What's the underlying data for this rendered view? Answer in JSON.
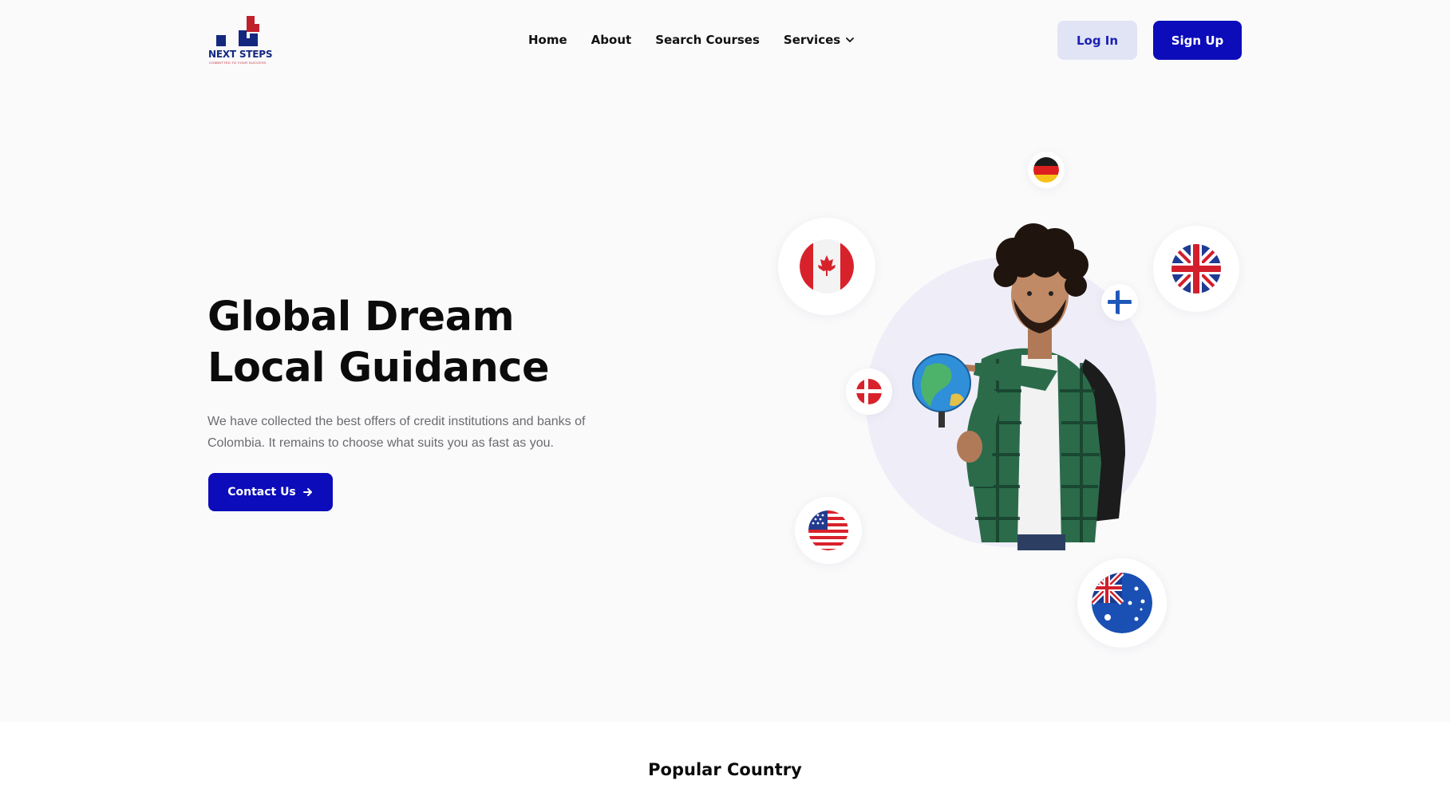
{
  "brand": {
    "name": "NEXT STEPS",
    "tagline": "COMMITTED TO YOUR SUCCESS",
    "colors": {
      "primary": "#0c0cba",
      "logo_blue": "#14287f",
      "logo_red": "#c0202a"
    }
  },
  "nav": {
    "items": [
      {
        "label": "Home"
      },
      {
        "label": "About"
      },
      {
        "label": "Search Courses"
      },
      {
        "label": "Services",
        "icon": "chevron-down-icon"
      }
    ]
  },
  "auth": {
    "login_label": "Log In",
    "signup_label": "Sign Up"
  },
  "hero": {
    "title_line1": "Global Dream",
    "title_line2": "Local Guidance",
    "description": "We have collected the best offers of credit institutions and banks of Colombia. It remains to choose what suits you as fast as you.",
    "cta_label": "Contact Us",
    "cta_icon": "arrow-right-icon",
    "flags": [
      "germany-flag-icon",
      "canada-flag-icon",
      "uk-flag-icon",
      "finland-flag-icon",
      "denmark-flag-icon",
      "usa-flag-icon",
      "australia-flag-icon"
    ]
  },
  "popular": {
    "title": "Popular Country"
  }
}
